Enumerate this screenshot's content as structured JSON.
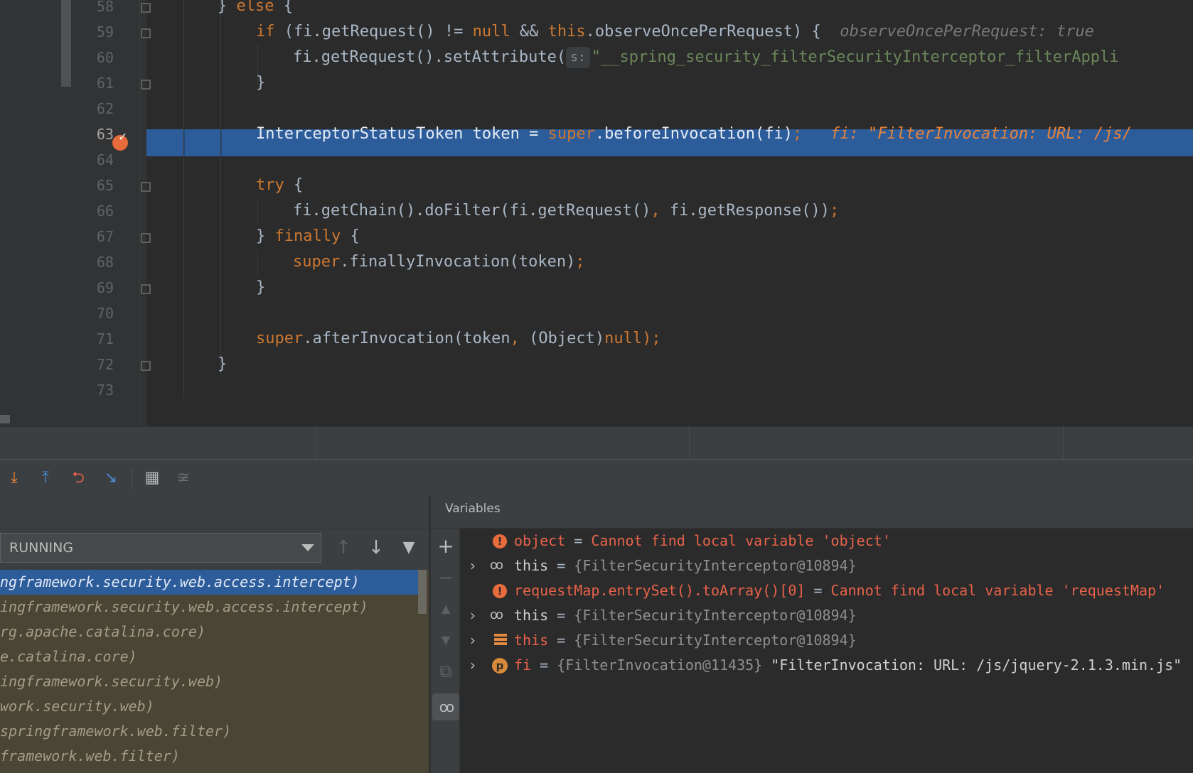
{
  "editor": {
    "line_numbers": [
      "58",
      "59",
      "60",
      "61",
      "62",
      "63",
      "64",
      "65",
      "66",
      "67",
      "68",
      "69",
      "70",
      "71",
      "72",
      "73"
    ],
    "current_line": "63",
    "lines": {
      "l58_close": "} ",
      "l58_else": "else",
      "l58_brace": " {",
      "l59_if": "if",
      "l59_cond_a": " (fi.getRequest() != ",
      "l59_null": "null",
      "l59_and": " && ",
      "l59_this": "this",
      "l59_cond_b": ".observeOncePerRequest) {",
      "l59_hint": "observeOncePerRequest: true",
      "l60_call": "fi.getRequest().setAttribute(",
      "l60_param_hint": "s:",
      "l60_str": "\"__spring_security_filterSecurityInterceptor_filterAppli",
      "l61_brace": "}",
      "l63_decl": "InterceptorStatusToken token = ",
      "l63_super": "super",
      "l63_call": ".beforeInvocation(fi)",
      "l63_semi": ";",
      "l63_inline": "fi: \"FilterInvocation: URL: /js/",
      "l65_try": "try",
      "l65_brace": " {",
      "l66_call": "fi.getChain().doFilter(fi.getRequest()",
      "l66_comma": ",",
      "l66_rest": " fi.getResponse())",
      "l66_semi": ";",
      "l67_close": "} ",
      "l67_finally": "finally",
      "l67_brace": " {",
      "l68_super": "super",
      "l68_call": ".finallyInvocation(token)",
      "l68_semi": ";",
      "l69_brace": "}",
      "l71_super": "super",
      "l71_call": ".afterInvocation(token",
      "l71_comma": ",",
      "l71_cast": " (Object)",
      "l71_null": "null",
      "l71_end": ");",
      "l72_brace": "}"
    }
  },
  "toolbar": {
    "icons": [
      "step-into-icon",
      "step-out-icon",
      "drop-frame-icon",
      "run-to-cursor-icon",
      "evaluate-expression-icon",
      "trace-icon"
    ]
  },
  "frames": {
    "thread_selected": "RUNNING",
    "items": [
      "ngframework.security.web.access.intercept)",
      "ingframework.security.web.access.intercept)",
      "rg.apache.catalina.core)",
      "e.catalina.core)",
      "ingframework.security.web)",
      "work.security.web)",
      "springframework.web.filter)",
      "framework.web.filter)"
    ]
  },
  "variables": {
    "title": "Variables",
    "rows": [
      {
        "name": "object",
        "eq": " = ",
        "value": "Cannot find local variable 'object'"
      },
      {
        "name": "this",
        "eq": " = ",
        "value": "{FilterSecurityInterceptor@10894}"
      },
      {
        "name": "requestMap.entrySet().toArray()[0]",
        "eq": " = ",
        "value": "Cannot find local variable 'requestMap'"
      },
      {
        "name": "this",
        "eq": " = ",
        "value": "{FilterSecurityInterceptor@10894}"
      },
      {
        "name": "this",
        "eq": " = ",
        "value": "{FilterSecurityInterceptor@10894}"
      },
      {
        "name": "fi",
        "eq": " = ",
        "value": "{FilterInvocation@11435}",
        "extra": " \"FilterInvocation: URL: /js/jquery-2.1.3.min.js\""
      }
    ]
  },
  "colors": {
    "keyword": "#cc7832",
    "selection": "#2d5c9a",
    "error": "#e9624a",
    "breakpoint": "#e86b3c"
  }
}
